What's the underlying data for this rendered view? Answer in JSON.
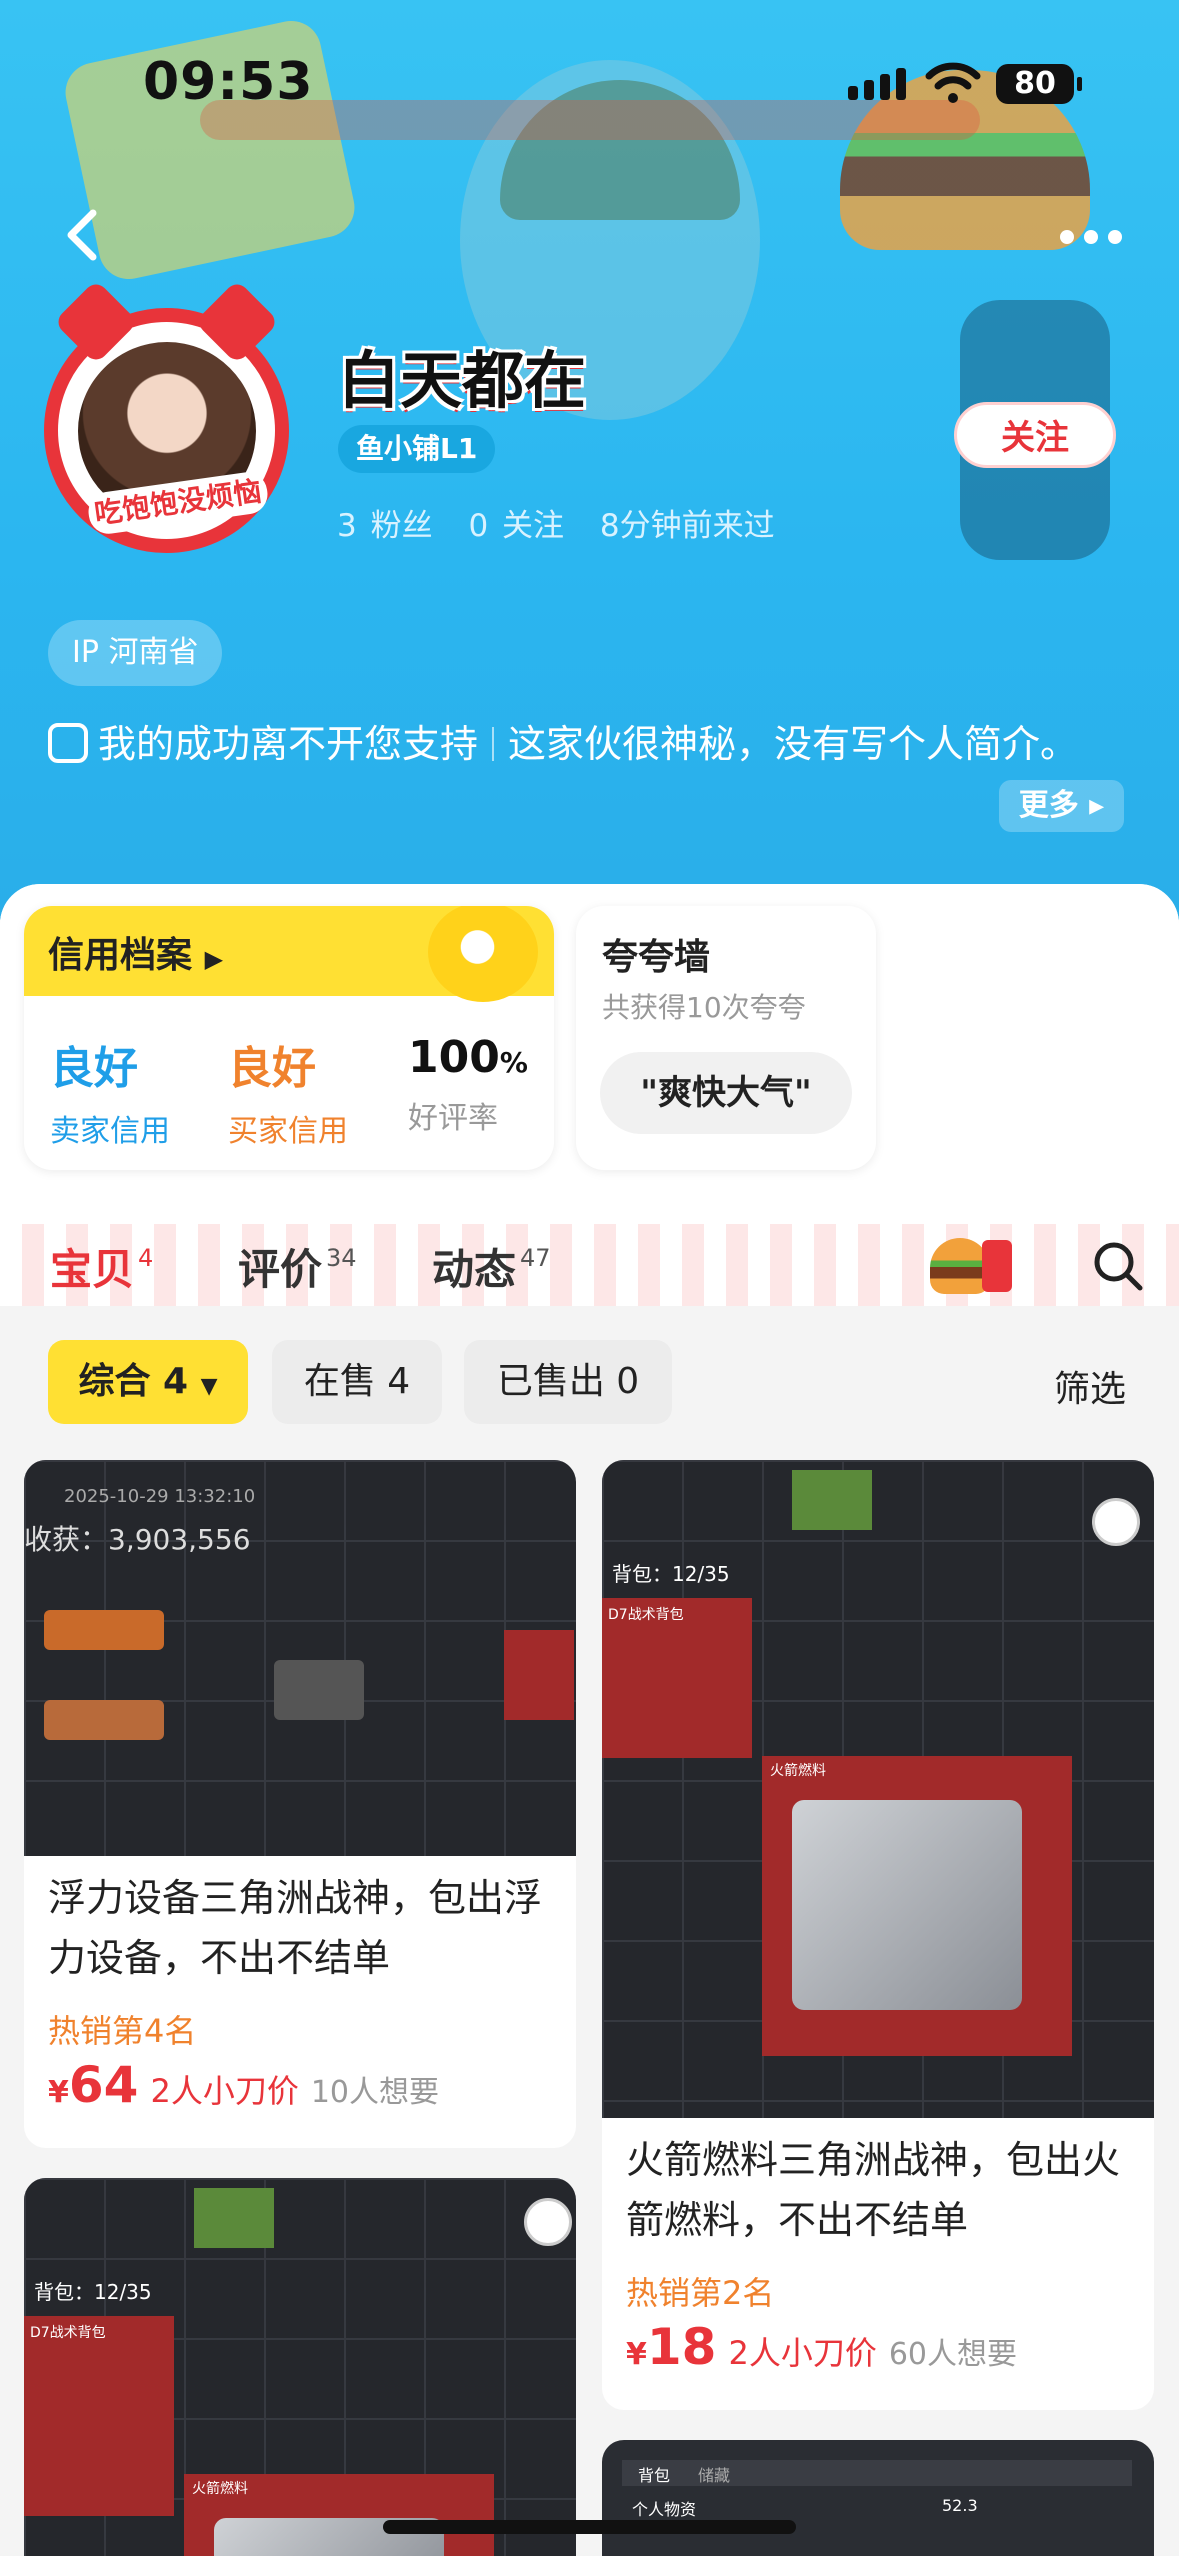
{
  "status": {
    "time": "09:53",
    "battery": "80"
  },
  "profile": {
    "name": "白天都在",
    "level": "鱼小铺L1",
    "avatar_badge": "吃饱饱没烦恼",
    "stats": {
      "fans": "3 粉丝",
      "following": "0 关注",
      "last_seen": "8分钟前来过"
    },
    "follow_label": "关注",
    "ip": "IP 河南省",
    "bio": "我的成功离不开您支持",
    "bio2": "这家伙很神秘，没有写个人简介。",
    "more_label": "更多"
  },
  "credit": {
    "title": "信用档案",
    "seller": {
      "value": "良好",
      "label": "卖家信用"
    },
    "buyer": {
      "value": "良好",
      "label": "买家信用"
    },
    "rate": {
      "value": "100",
      "unit": "%",
      "label": "好评率"
    }
  },
  "praise": {
    "title": "夸夸墙",
    "subtitle": "共获得10次夸夸",
    "chip": "\"爽快大气\""
  },
  "tabs": [
    {
      "label": "宝贝",
      "count": "4"
    },
    {
      "label": "评价",
      "count": "34"
    },
    {
      "label": "动态",
      "count": "47"
    }
  ],
  "filters": {
    "all": "综合 4",
    "on_sale": "在售 4",
    "sold": "已售出 0",
    "sieve": "筛选"
  },
  "items": [
    {
      "title": "浮力设备三角洲战神，包出浮力设备，不出不结单",
      "hot": "热销第4名",
      "price": "64",
      "cut": "2人小刀价",
      "want": "10人想要",
      "shot_date": "2025-10-29 13:32:10",
      "shot_value": "收获：3,903,556"
    },
    {
      "title": "火箭燃料三角洲战神，包出火箭燃料，不出不结单",
      "hot": "热销第2名",
      "price": "18",
      "cut": "2人小刀价",
      "want": "60人想要",
      "shot_bag": "背包：12/35",
      "shot_item": "火箭燃料",
      "shot_pack": "D7战术背包"
    },
    {
      "shot_bag": "背包：12/35",
      "shot_item": "火箭燃料",
      "shot_pack": "D7战术背包"
    },
    {
      "shot_tab1": "背包",
      "shot_tab2": "储藏",
      "shot_label": "个人物资",
      "shot_num": "52.3"
    }
  ],
  "colors": {
    "brand_blue": "#2bb6f0",
    "accent_red": "#e8343a",
    "credit_yellow": "#ffe033",
    "seller_blue": "#1f9ee8",
    "buyer_orange": "#f0822d"
  }
}
